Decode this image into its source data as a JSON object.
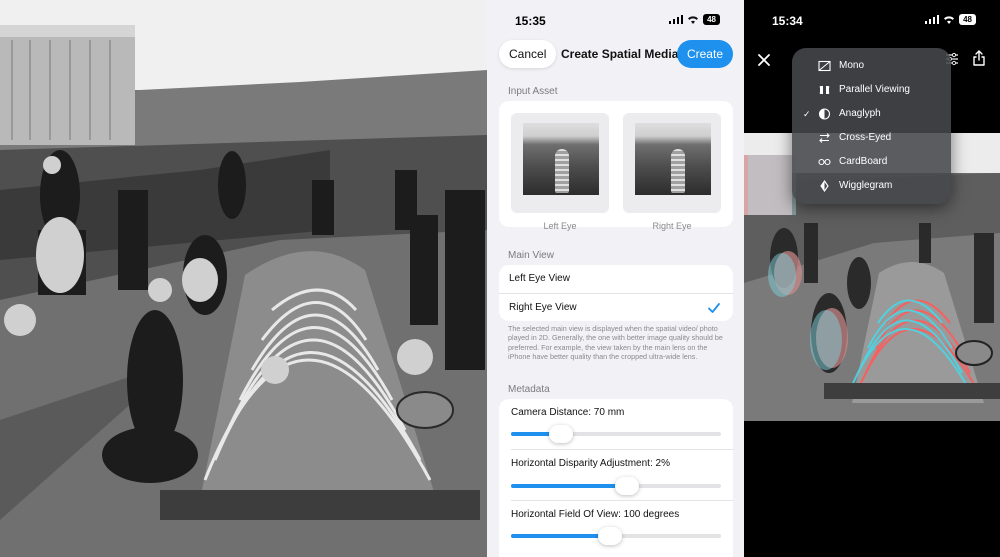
{
  "middle": {
    "status": {
      "time": "15:35",
      "battery": "48"
    },
    "nav": {
      "cancel": "Cancel",
      "title": "Create Spatial Media",
      "create": "Create"
    },
    "input_asset": {
      "header": "Input Asset",
      "left_eye": "Left Eye",
      "right_eye": "Right Eye"
    },
    "main_view": {
      "header": "Main View",
      "options": [
        "Left Eye View",
        "Right Eye View"
      ],
      "selected": "Right Eye View",
      "footnote": "The selected main view is displayed when the spatial video/ photo played in 2D. Generally, the one with better image quality should be preferred. For example, the view taken by the main lens on the iPhone have better quality than the cropped ultra-wide lens."
    },
    "metadata": {
      "header": "Metadata",
      "camera_distance": {
        "label": "Camera Distance: 70 mm",
        "fraction": 0.24
      },
      "disparity": {
        "label": "Horizontal Disparity Adjustment: 2%",
        "fraction": 0.55
      },
      "fov": {
        "label": "Horizontal Field Of View: 100 degrees",
        "fraction": 0.47
      }
    }
  },
  "right": {
    "status": {
      "time": "15:34",
      "battery": "48"
    },
    "menu": {
      "items": [
        {
          "label": "Mono",
          "icon": "mono-icon",
          "checked": false
        },
        {
          "label": "Parallel Viewing",
          "icon": "parallel-icon",
          "checked": false
        },
        {
          "label": "Anaglyph",
          "icon": "anaglyph-icon",
          "checked": true
        },
        {
          "label": "Cross-Eyed",
          "icon": "cross-eyed-icon",
          "checked": false
        },
        {
          "label": "CardBoard",
          "icon": "cardboard-icon",
          "checked": false
        },
        {
          "label": "Wigglegram",
          "icon": "wigglegram-icon",
          "checked": false
        }
      ]
    }
  },
  "colors": {
    "accent": "#1e90ee",
    "page_bg": "#f2f2f6"
  }
}
